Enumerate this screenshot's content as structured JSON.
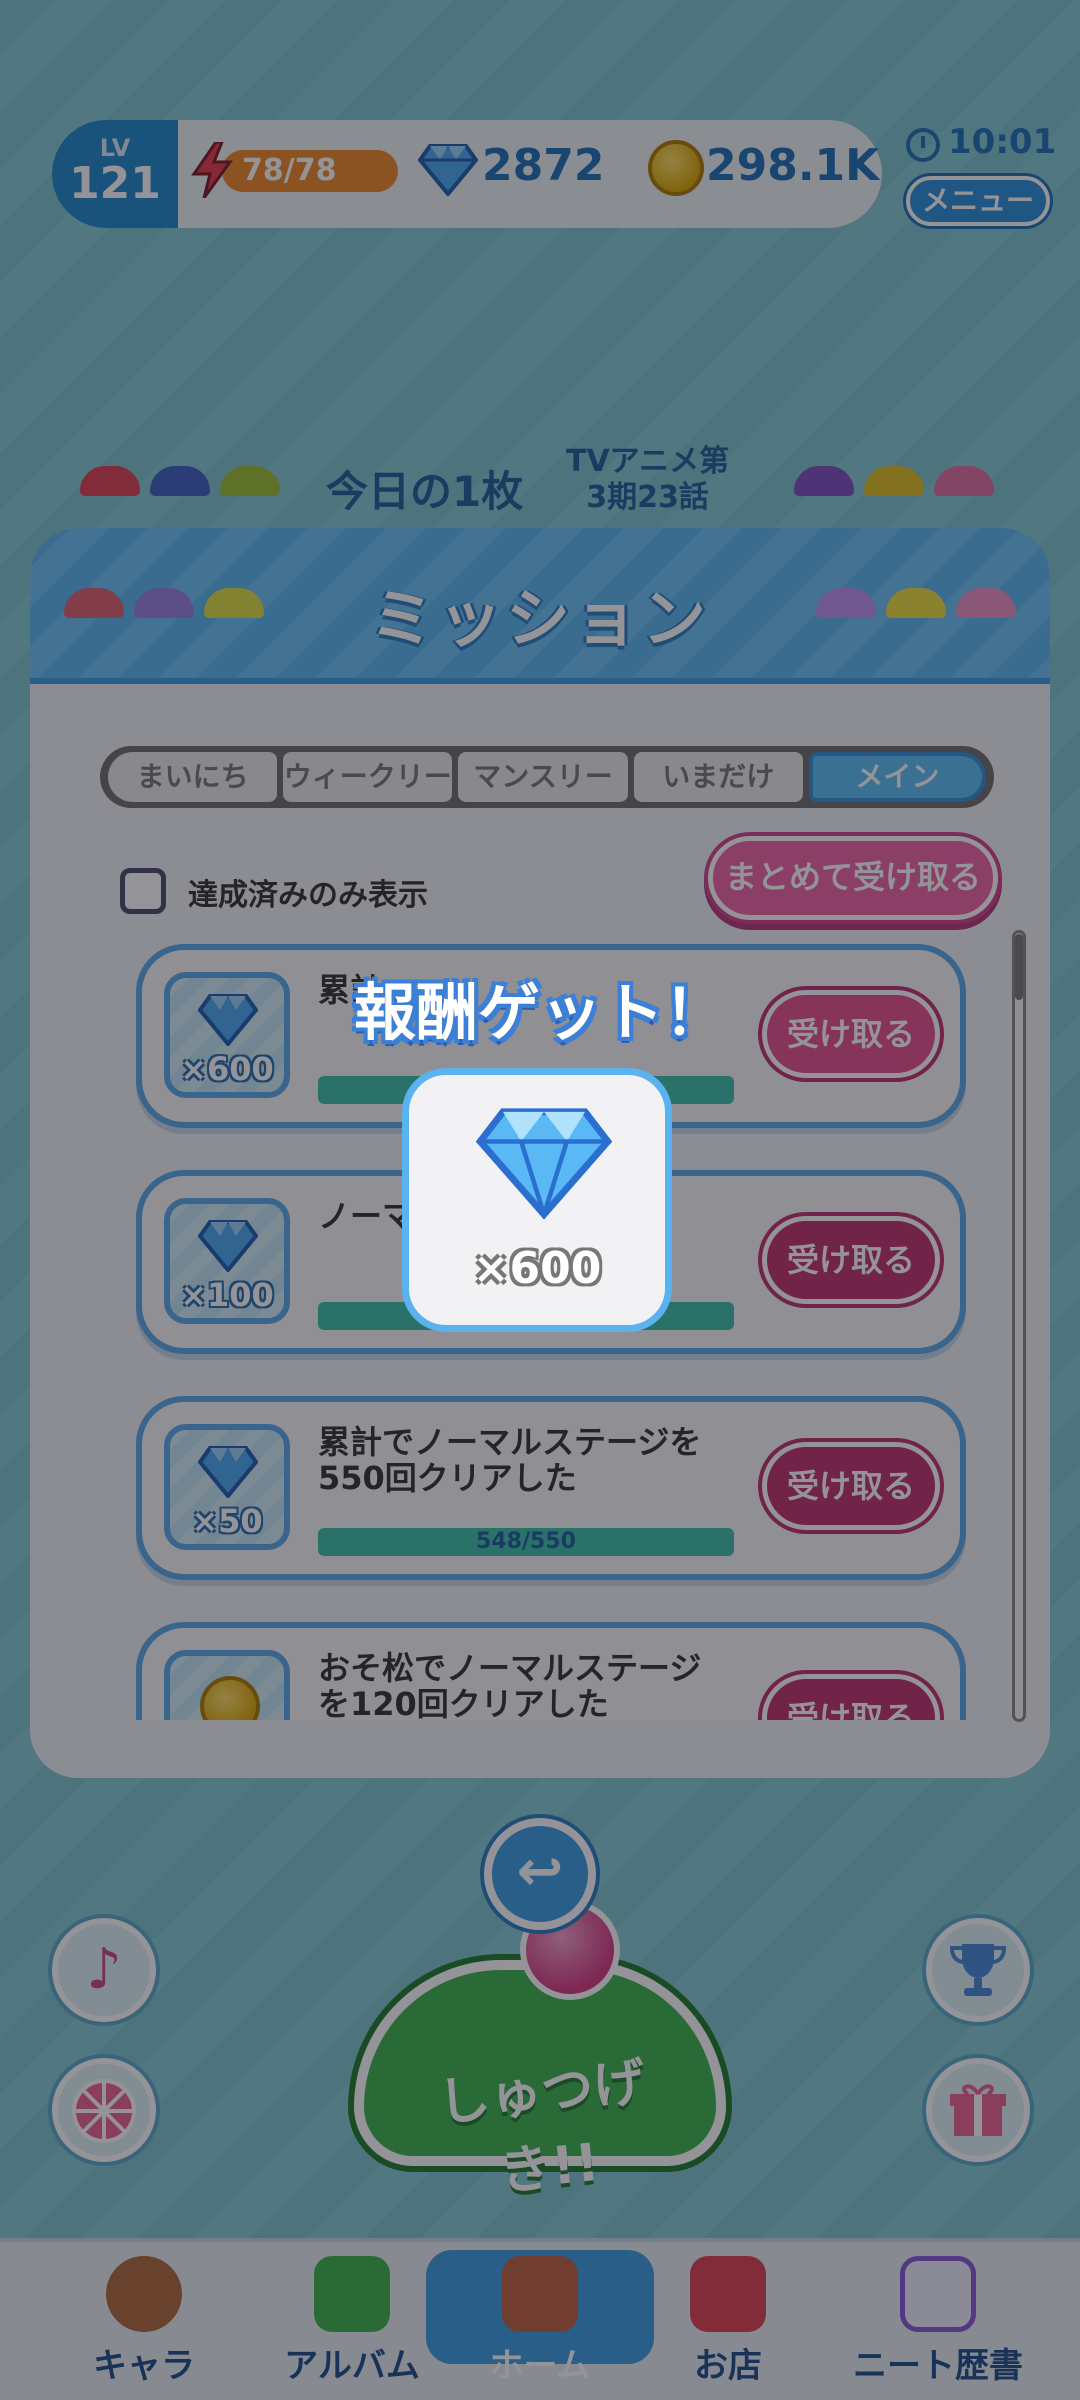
{
  "hud": {
    "level_label": "LV",
    "level": "121",
    "stamina": "78/78",
    "gems": "2872",
    "coins": "298.1K",
    "time": "10:01",
    "menu_label": "メニュー"
  },
  "header_strip": {
    "today_label": "今日の1枚",
    "episode_line1": "TVアニメ第",
    "episode_line2": "3期23話"
  },
  "mission_panel": {
    "title": "ミッション",
    "tabs": [
      {
        "label": "まいにち",
        "active": false
      },
      {
        "label": "ウィークリー",
        "active": false
      },
      {
        "label": "マンスリー",
        "active": false
      },
      {
        "label": "いまだけ",
        "active": false
      },
      {
        "label": "メイン",
        "active": true
      }
    ],
    "filter_label": "達成済みのみ表示",
    "bulk_claim_label": "まとめて受け取る",
    "missions": [
      {
        "reward_qty": "×600",
        "reward_icon": "gem-icon",
        "title": "累計…",
        "progress_text": "",
        "claim_label": "受け取る"
      },
      {
        "reward_qty": "×100",
        "reward_icon": "gem-icon",
        "title": "ノーマ…リ アした…",
        "progress_text": "",
        "claim_label": "受け取る"
      },
      {
        "reward_qty": "×50",
        "reward_icon": "gem-icon",
        "title": "累計でノーマルステージを550回クリアした",
        "progress_text": "548/550",
        "claim_label": "受け取る"
      },
      {
        "reward_qty": "",
        "reward_icon": "coin-icon",
        "title": "おそ松でノーマルステージを120回クリアした",
        "progress_text": "",
        "claim_label": "受け取る"
      }
    ]
  },
  "sortie": {
    "label": "しゅつげき!!"
  },
  "bottom_nav": [
    {
      "label": "キャラ",
      "icon": "character-icon"
    },
    {
      "label": "アルバム",
      "icon": "album-icon"
    },
    {
      "label": "ホーム",
      "icon": "home-icon"
    },
    {
      "label": "お店",
      "icon": "shop-icon"
    },
    {
      "label": "ニート歴書",
      "icon": "resume-icon"
    }
  ],
  "reward_popup": {
    "title": "報酬ゲット！",
    "quantity": "×600",
    "icon": "gem-icon"
  },
  "colors": {
    "accent_blue": "#3a9ee0",
    "claim_pink": "#e8508c",
    "progress_green": "#3dc2a8"
  }
}
